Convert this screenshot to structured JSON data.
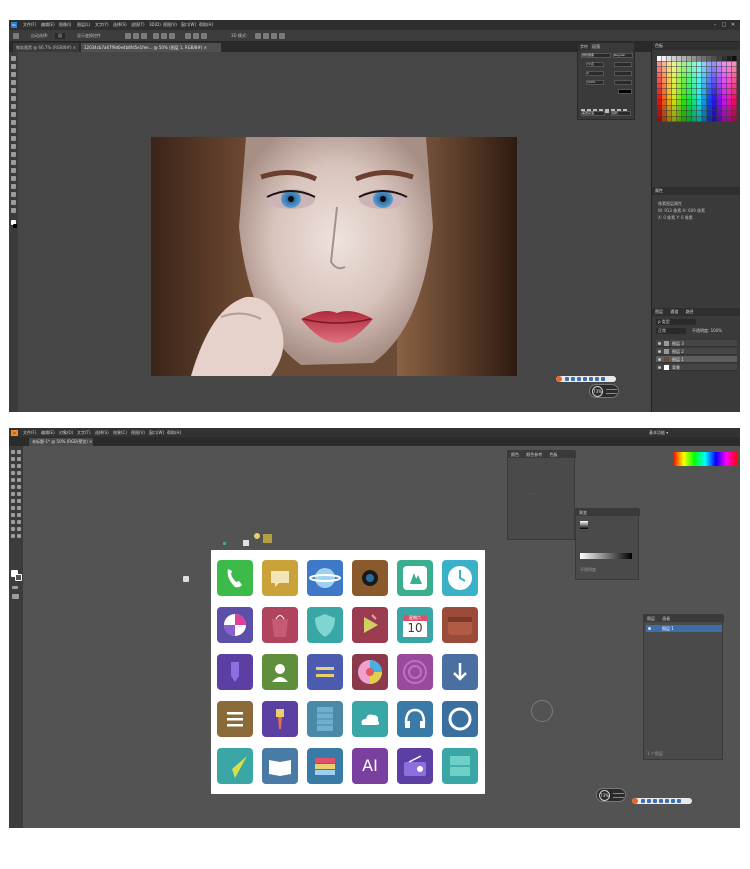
{
  "photoshop": {
    "menu": [
      "文件(F)",
      "编辑(E)",
      "图像(I)",
      "图层(L)",
      "文字(Y)",
      "选择(S)",
      "滤镜(T)",
      "3D(D)",
      "视图(V)",
      "窗口(W)",
      "帮助(H)"
    ],
    "window_controls": [
      "–",
      "□",
      "✕"
    ],
    "options_text": [
      "自动选择:",
      "组",
      "显示变换控件"
    ],
    "options_right_text": "3D 模式:",
    "tabs": [
      {
        "label": "微软雅黑 @ 66.7% (RGB/8#) ×"
      },
      {
        "label": "12034cb7a67f9d0e4b8fd5e1fee... @ 50% (图层 1, RGB/8#) ×"
      }
    ],
    "character_panel": {
      "tabs": [
        "字符",
        "段落"
      ],
      "font": "微软雅黑",
      "style": "Regular",
      "size": "72点",
      "tracking": "0",
      "scale": "100%",
      "language": "美国英语",
      "aa": "锐利"
    },
    "adjust_panel": {
      "tab": "属性",
      "lines": [
        "像素图层属性",
        "W: 913 像素   H: 609 像素",
        "X: 0 像素    Y: 0 像素"
      ]
    },
    "layers_panel": {
      "tabs": [
        "图层",
        "通道",
        "路径"
      ],
      "kind": "ρ 类型",
      "blend": "正常",
      "opacity": "不透明度: 100%",
      "layers": [
        {
          "name": "图层 3",
          "selected": false
        },
        {
          "name": "图层 2",
          "selected": false
        },
        {
          "name": "图层 1",
          "selected": true
        },
        {
          "name": "背景",
          "selected": false
        }
      ]
    },
    "zoom": "73%"
  },
  "illustrator": {
    "menu": [
      "文件(F)",
      "编辑(E)",
      "对象(O)",
      "文字(T)",
      "选择(S)",
      "效果(C)",
      "视图(V)",
      "窗口(W)",
      "帮助(H)"
    ],
    "workspace": "基本功能 ▾",
    "tab": "未标题-1* @ 50% (RGB/预览) ×",
    "color_panel_tabs": [
      "颜色",
      "颜色参考",
      "色板"
    ],
    "gradient_panel_tab": "渐变",
    "transparency_text": "不透明度",
    "layers_panel": {
      "tabs": [
        "图层",
        "画板"
      ],
      "layer": "图层 1",
      "footer": "1 个图层"
    },
    "zoom": "73%",
    "icon_grid": {
      "rows": 5,
      "cols": 6,
      "tiles": [
        {
          "name": "phone-icon",
          "color": "#3dbb4a"
        },
        {
          "name": "message-icon",
          "color": "#c9a23a"
        },
        {
          "name": "planet-icon",
          "color": "#3d79c7"
        },
        {
          "name": "camera-icon",
          "color": "#8b5a2b"
        },
        {
          "name": "tree-icon",
          "color": "#3aaf8f"
        },
        {
          "name": "clock-icon",
          "color": "#3bb0c9"
        },
        {
          "name": "pinwheel-icon",
          "color": "#5b4fa8"
        },
        {
          "name": "bag-icon",
          "color": "#b0445e"
        },
        {
          "name": "shield-icon",
          "color": "#3aa6a6"
        },
        {
          "name": "video-play-icon",
          "color": "#9a3b4f"
        },
        {
          "name": "calendar-icon",
          "color": "#3aa6a6",
          "text": "10",
          "subtext": "星期六"
        },
        {
          "name": "wallet-icon",
          "color": "#9a4b3a"
        },
        {
          "name": "pen-icon",
          "color": "#5b3fa3"
        },
        {
          "name": "contact-icon",
          "color": "#5f8f3a"
        },
        {
          "name": "notes-icon",
          "color": "#4a5bb0"
        },
        {
          "name": "color-wheel-icon",
          "color": "#8a3a4a"
        },
        {
          "name": "snail-icon",
          "color": "#9a4a9a"
        },
        {
          "name": "download-icon",
          "color": "#4a6fa0"
        },
        {
          "name": "menu-list-icon",
          "color": "#8b6a3a"
        },
        {
          "name": "brush-icon",
          "color": "#5b3fa3"
        },
        {
          "name": "paper-icon",
          "color": "#4a8aa6"
        },
        {
          "name": "cloud-icon",
          "color": "#3aa6a6"
        },
        {
          "name": "headphones-icon",
          "color": "#3a7aa6"
        },
        {
          "name": "record-icon",
          "color": "#3a6fa0"
        },
        {
          "name": "paper-plane-icon",
          "color": "#3aa6a6"
        },
        {
          "name": "book-icon",
          "color": "#4a7aa6"
        },
        {
          "name": "stack-icon",
          "color": "#3a7aa6"
        },
        {
          "name": "ai-icon",
          "color": "#7b3fa0",
          "text": "AI"
        },
        {
          "name": "radio-icon",
          "color": "#5b3fa3"
        },
        {
          "name": "window-icon",
          "color": "#3aa6a6"
        }
      ]
    }
  }
}
